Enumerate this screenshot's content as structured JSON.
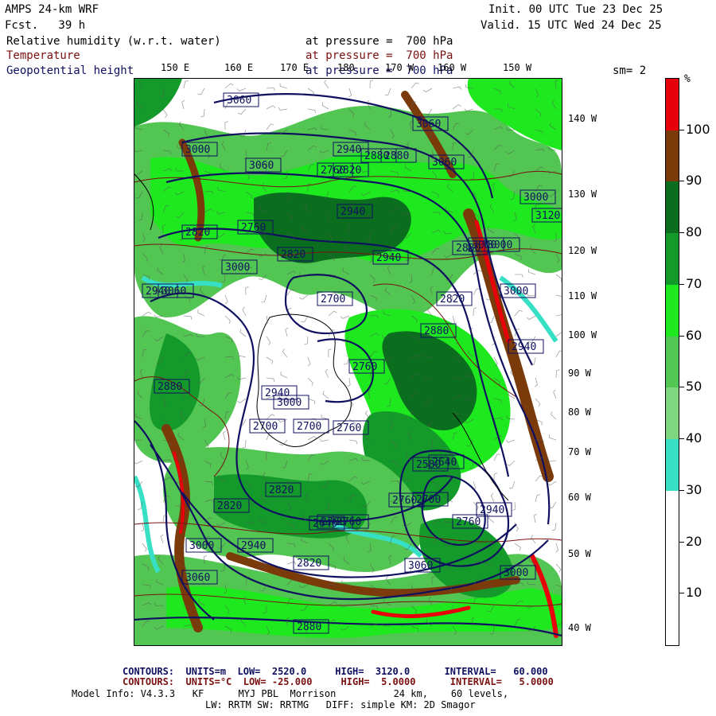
{
  "header": {
    "title_left": "AMPS 24-km WRF",
    "fcst_line": "Fcst.   39 h",
    "init_line": "Init. 00 UTC Tue 23 Dec 25",
    "valid_line": "Valid. 15 UTC Wed 24 Dec 25",
    "field1_name": "Relative humidity (w.r.t. water)",
    "field1_level": "at pressure =  700 hPa",
    "field2_name": "Temperature",
    "field2_level": "at pressure =  700 hPa",
    "field3_name": "Geopotential height",
    "field3_level": "at pressure =  700 hPa",
    "smoothing": "sm= 2"
  },
  "colors": {
    "rh_100": "#e8000b",
    "rh_90": "#7a3a0a",
    "rh_80": "#0b6e1f",
    "rh_70": "#139a2a",
    "rh_60": "#1ee81e",
    "rh_50": "#52c552",
    "rh_40": "#7ed67e",
    "rh_30": "#37e0c5",
    "rh_below": "#ffffff",
    "height_contour": "#101060",
    "temp_contour": "#7a1010"
  },
  "colorbar": {
    "unit": "%",
    "labels": [
      "100",
      "90",
      "80",
      "70",
      "60",
      "50",
      "40",
      "30",
      "20",
      "10"
    ]
  },
  "lon_labels": [
    "150 E",
    "160 E",
    "170 E",
    "180",
    "170 W",
    "160 W",
    "150 W"
  ],
  "lat_side_labels": [
    "140 W",
    "130 W",
    "120 W",
    "110 W",
    "100 W",
    "90 W",
    "80 W",
    "70 W",
    "60 W",
    "50 W",
    "40 W"
  ],
  "height_labels": [
    "3060",
    "3060",
    "3000",
    "2940",
    "2880",
    "3060",
    "2760",
    "3060",
    "2820",
    "2880",
    "3000",
    "2940",
    "3000",
    "3120",
    "3000",
    "2820",
    "2940",
    "2880",
    "2820",
    "2760",
    "2700",
    "3060",
    "3000",
    "2940",
    "3000",
    "2880",
    "2940",
    "2820",
    "2760",
    "2700",
    "2760",
    "2700",
    "2760",
    "3000",
    "2940",
    "2880",
    "2820",
    "2760",
    "2700",
    "2640",
    "2580",
    "3000",
    "3060",
    "2820",
    "2700",
    "2820",
    "2940",
    "2640",
    "2760",
    "3000",
    "3060",
    "2880",
    "2940"
  ],
  "footer": {
    "contours1": "CONTOURS:  UNITS=m  LOW=  2520.0     HIGH=  3120.0      INTERVAL=   60.000",
    "contours2": "CONTOURS:  UNITS=°C  LOW= -25.000     HIGH=  5.0000      INTERVAL=   5.0000",
    "model_info": "Model Info: V4.3.3   KF      MYJ PBL  Morrison          24 km,    60 levels,",
    "model_info2": "LW: RRTM SW: RRTMG   DIFF: simple KM: 2D Smagor"
  }
}
